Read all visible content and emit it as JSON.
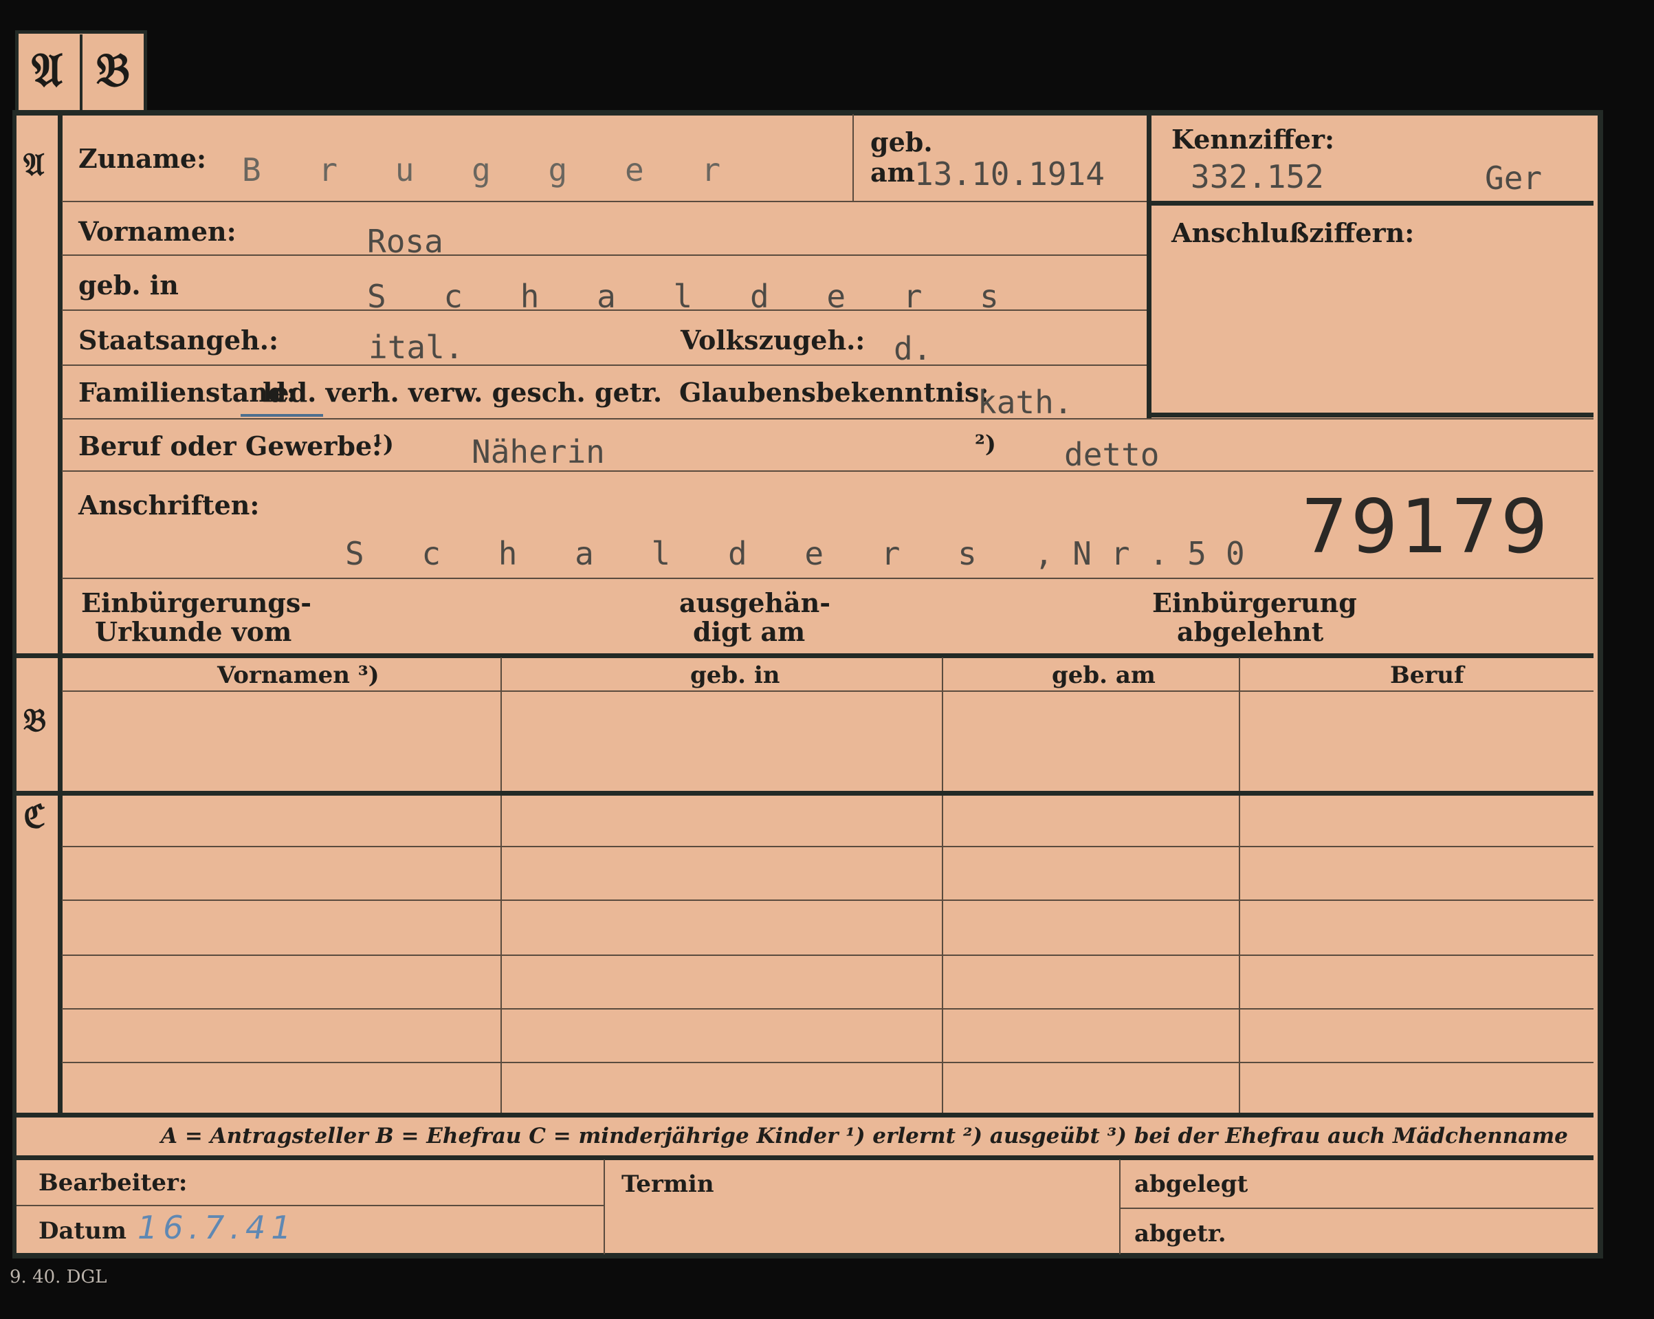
{
  "tabs": {
    "a": "𝔄",
    "b": "𝔅"
  },
  "sections": {
    "a": "𝔄",
    "b": "𝔅",
    "c": "ℭ"
  },
  "header": {
    "surname_label": "Zuname:",
    "surname_value": "B r u g g e r",
    "birth_label_line1": "geb.",
    "birth_label_line2": "am",
    "birth_date": "13.10.1914",
    "reference_label": "Kennziffer:",
    "reference_value": "332.152",
    "reference_suffix": "Ger",
    "connection_label": "Anschlußziffern:"
  },
  "fields": {
    "first_names_label": "Vornamen:",
    "first_names_value": "Rosa",
    "birthplace_label": "geb. in",
    "birthplace_value": "S c h a l d e r s",
    "citizenship_label": "Staatsangeh.:",
    "citizenship_value": "ital.",
    "ethnicity_label": "Volkszugeh.:",
    "ethnicity_value": "d.",
    "marital_label": "Familienstand:",
    "marital_options": "led. verh. verw. gesch. getr.",
    "religion_label": "Glaubensbekenntnis:",
    "religion_value": "kath.",
    "occupation_label": "Beruf oder Gewerbe:",
    "occupation_note1": "¹)",
    "occupation_value1": "Näherin",
    "occupation_note2": "²)",
    "occupation_value2": "detto",
    "address_label": "Anschriften:",
    "address_value": "S c h a l d e r s ,Nr.50",
    "handwritten_number": "79179",
    "naturalization_label_line1": "Einbürgerungs-",
    "naturalization_label_line2": "Urkunde vom",
    "issued_label_line1": "ausgehän-",
    "issued_label_line2": "digt am",
    "rejected_label_line1": "Einbürgerung",
    "rejected_label_line2": "abgelehnt"
  },
  "table": {
    "headers": [
      "Vornamen ³)",
      "geb. in",
      "geb. am",
      "Beruf"
    ]
  },
  "legend": {
    "text": "A = Antragsteller   B = Ehefrau   C = minderjährige Kinder   ¹) erlernt   ²) ausgeübt   ³) bei der Ehefrau auch Mädchenname"
  },
  "footer": {
    "clerk_label": "Bearbeiter:",
    "date_label": "Datum",
    "date_value": "16.7.41",
    "deadline_label": "Termin",
    "filed_label": "abgelegt",
    "forwarded_label": "abgetr."
  },
  "print_code": "9. 40. DGL"
}
